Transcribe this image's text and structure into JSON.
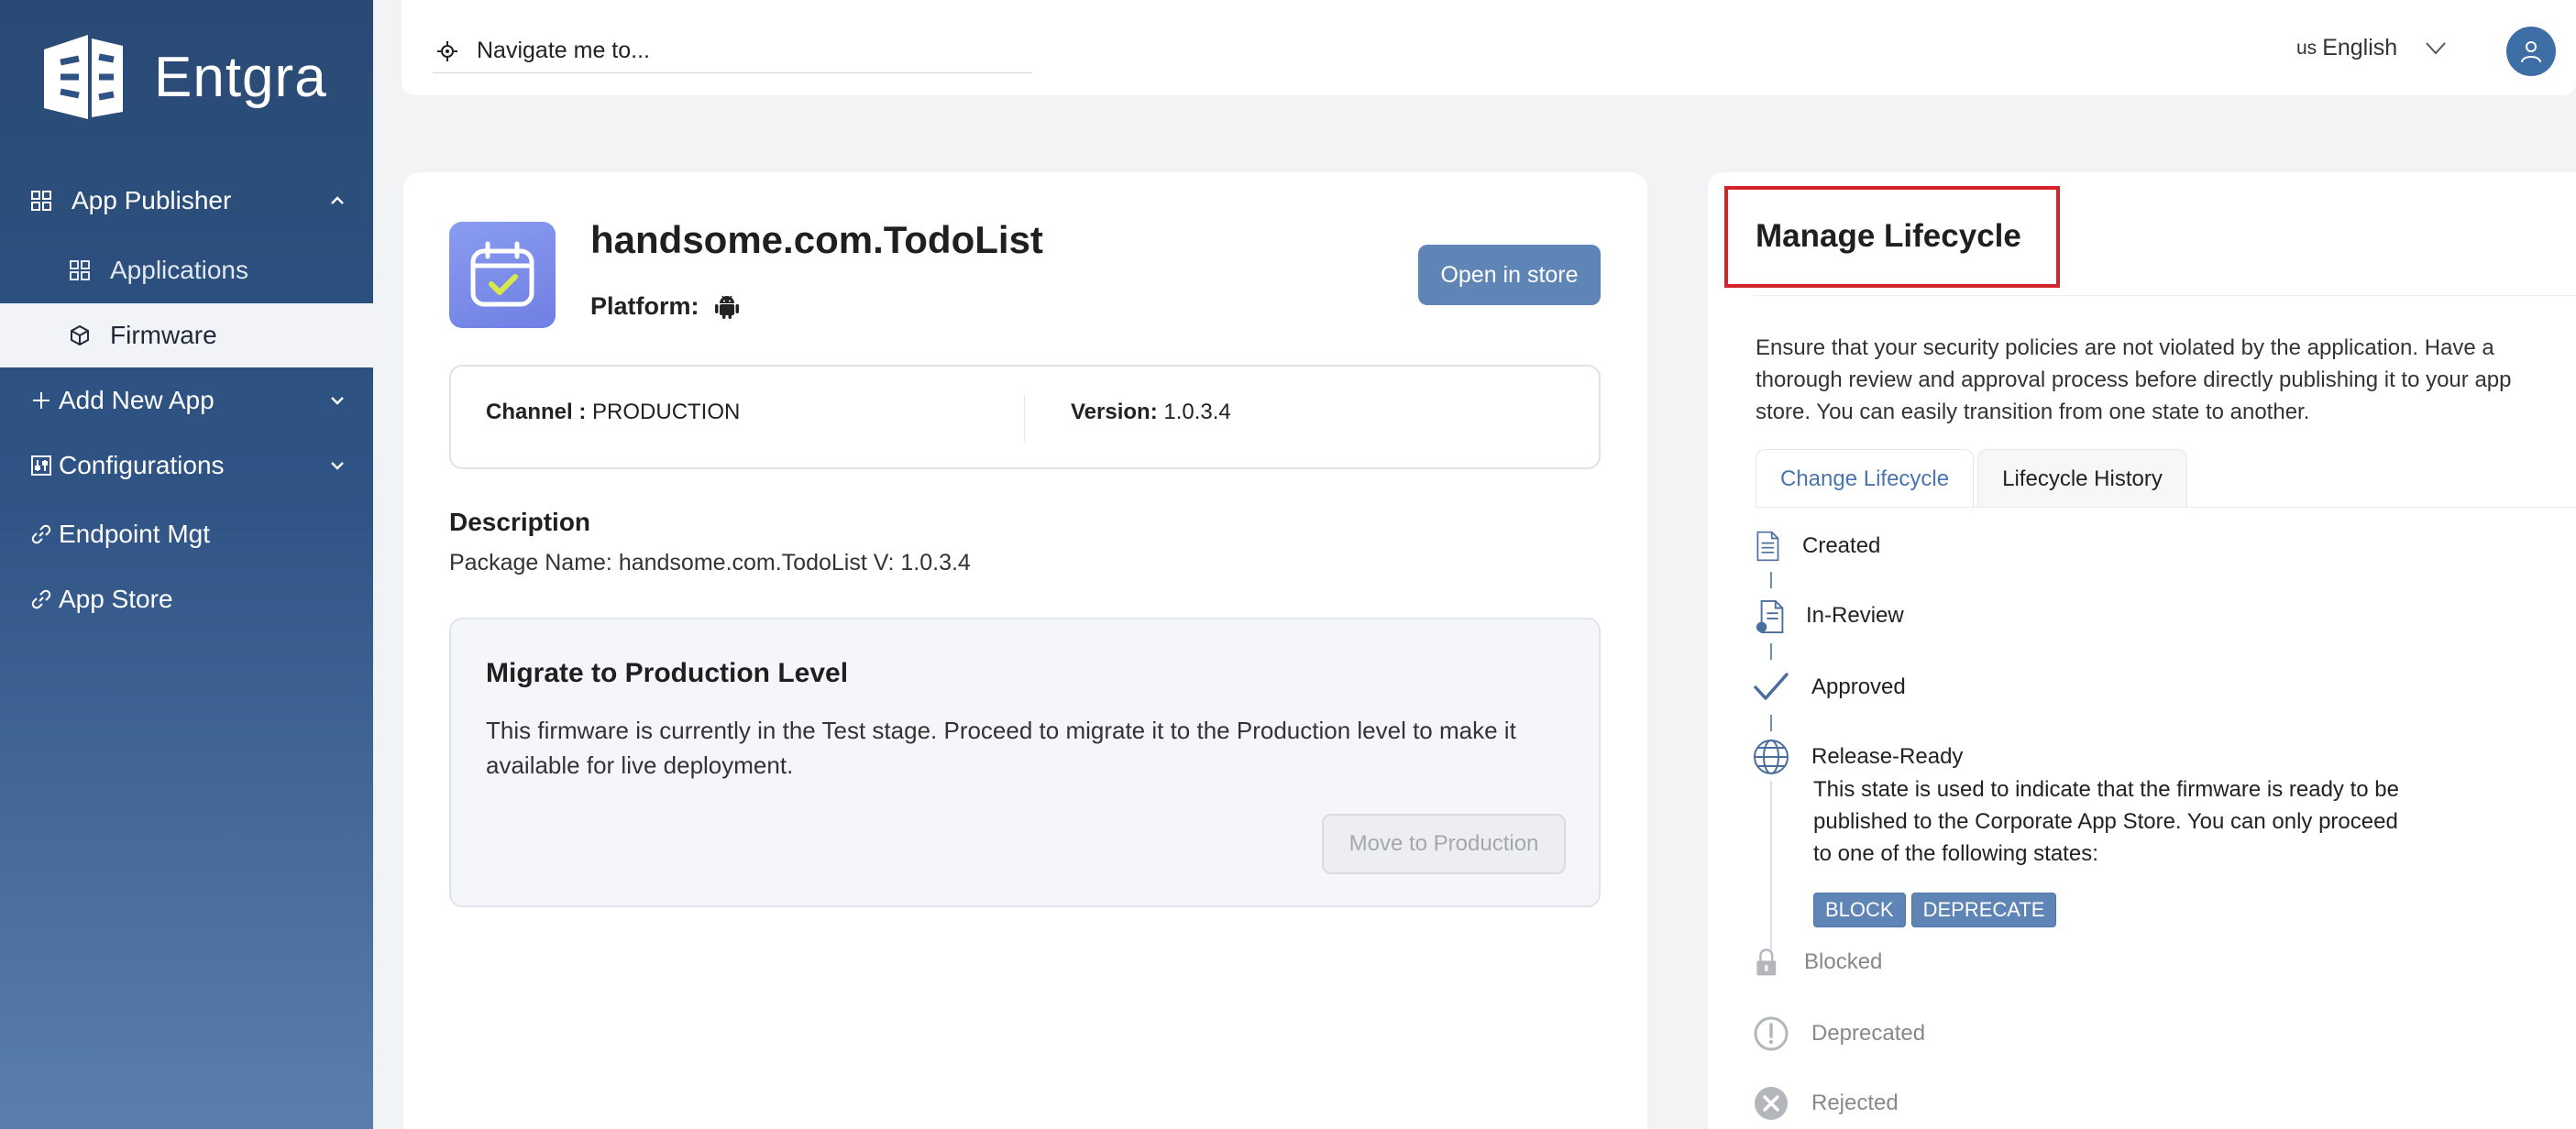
{
  "brand": {
    "name": "Entgra"
  },
  "sidebar": {
    "items": [
      {
        "label": "App Publisher"
      },
      {
        "label": "Applications"
      },
      {
        "label": "Firmware"
      },
      {
        "label": "Add New App"
      },
      {
        "label": "Configurations"
      },
      {
        "label": "Endpoint Mgt"
      },
      {
        "label": "App Store"
      }
    ]
  },
  "header": {
    "search_placeholder": "Navigate me to...",
    "language_flag": "us",
    "language": "English"
  },
  "app": {
    "title": "handsome.com.TodoList",
    "platform_label": "Platform:",
    "open_store_label": "Open in store",
    "channel_label": "Channel :",
    "channel_value": "PRODUCTION",
    "version_label": "Version:",
    "version_value": "1.0.3.4",
    "description_title": "Description",
    "description_text": "Package Name: handsome.com.TodoList V: 1.0.3.4"
  },
  "migrate": {
    "title": "Migrate to Production Level",
    "text": "This firmware is currently in the Test stage. Proceed to migrate it to the Production level to make it available for live deployment.",
    "button_label": "Move to Production"
  },
  "lifecycle": {
    "title": "Manage Lifecycle",
    "intro": "Ensure that your security policies are not violated by the application. Have a thorough review and approval process before directly publishing it to your app store. You can easily transition from one state to another.",
    "tabs": [
      {
        "label": "Change Lifecycle"
      },
      {
        "label": "Lifecycle History"
      }
    ],
    "steps": [
      {
        "label": "Created"
      },
      {
        "label": "In-Review"
      },
      {
        "label": "Approved"
      },
      {
        "label": "Release-Ready"
      },
      {
        "label": "Blocked"
      },
      {
        "label": "Deprecated"
      },
      {
        "label": "Rejected"
      }
    ],
    "release_ready_desc": "This state is used to indicate that the firmware is ready to be published to the Corporate App Store. You can only proceed to one of the following states:",
    "next_states": [
      {
        "label": "BLOCK"
      },
      {
        "label": "DEPRECATE"
      }
    ]
  },
  "colors": {
    "accent": "#5f85b7",
    "sidebar_top": "#294a74",
    "highlight": "#d4232b"
  }
}
